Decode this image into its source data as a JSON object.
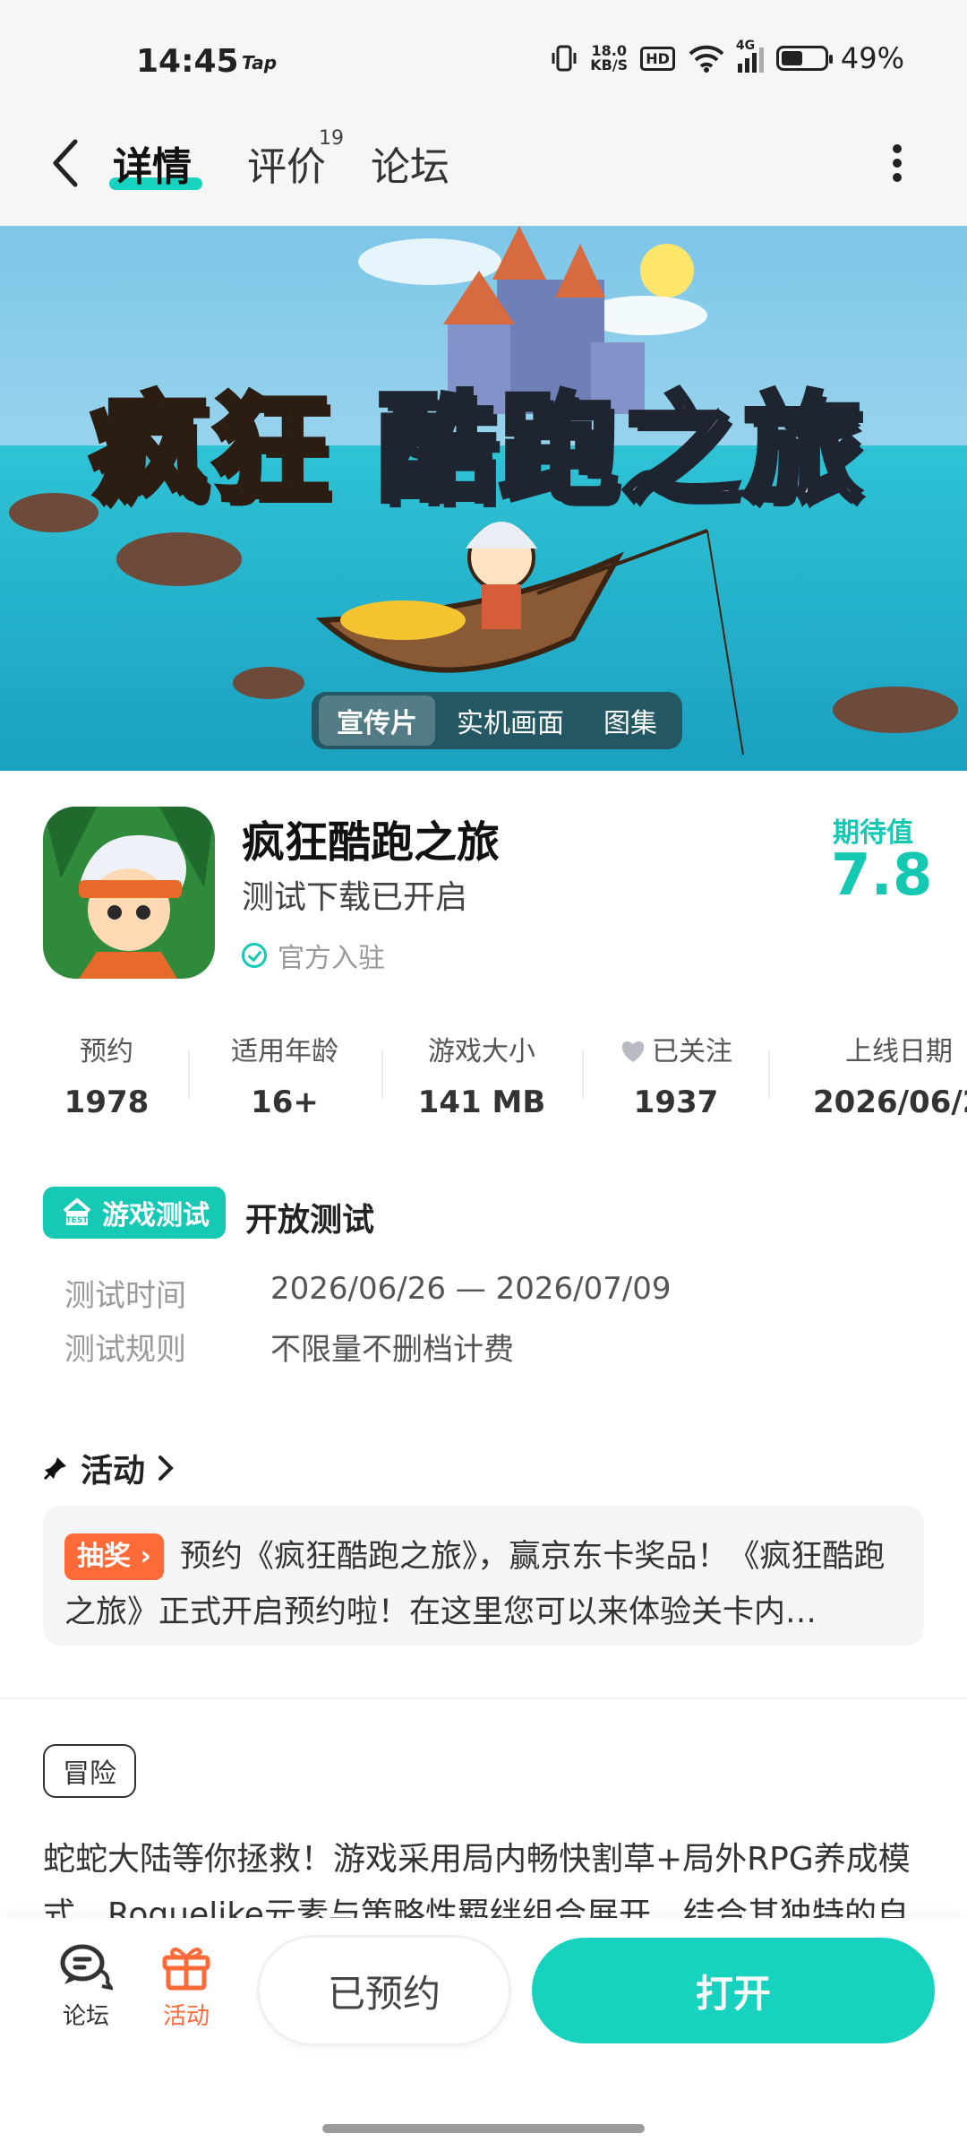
{
  "status_bar": {
    "time": "14:45",
    "app_badge": "Tap",
    "net_speed_value": "18.0",
    "net_speed_unit": "KB/S",
    "hd": "HD",
    "signal": "4G",
    "battery": "49%",
    "battery_level": 0.49
  },
  "nav": {
    "tabs": [
      {
        "label": "详情",
        "active": true
      },
      {
        "label": "评价",
        "count": "19"
      },
      {
        "label": "论坛"
      }
    ]
  },
  "hero": {
    "title_part1": "疯狂",
    "title_part2": "酷跑之旅",
    "media_tabs": [
      "宣传片",
      "实机画面",
      "图集"
    ]
  },
  "game": {
    "name": "疯狂酷跑之旅",
    "subtitle": "测试下载已开启",
    "official": "官方入驻",
    "expect_label": "期待值",
    "expect_value": "7.8"
  },
  "stats": [
    {
      "label": "预约",
      "value": "1978"
    },
    {
      "label": "适用年龄",
      "value": "16+"
    },
    {
      "label": "游戏大小",
      "value": "141 MB"
    },
    {
      "label": "已关注",
      "value": "1937"
    },
    {
      "label": "上线日期",
      "value": "2026/06/2"
    }
  ],
  "test": {
    "badge": "游戏测试",
    "badge_icon_text": "TEST",
    "type": "开放测试",
    "rows": [
      {
        "label": "测试时间",
        "value": "2026/06/26 — 2026/07/09"
      },
      {
        "label": "测试规则",
        "value": "不限量不删档计费"
      }
    ]
  },
  "activity": {
    "title": "活动",
    "tag": "抽奖",
    "text": "预约《疯狂酷跑之旅》，赢京东卡奖品！《疯狂酷跑之旅》正式开启预约啦！在这里您可以来体验关卡内…"
  },
  "genre_tag": "冒险",
  "description": "蛇蛇大陆等你拯救！游戏采用局内畅快割草+局外RPG养成模式，Roguelike元素与策略性羁绊组合展开，结合其独特的自",
  "bottom": {
    "forum": "论坛",
    "activity": "活动",
    "reserved": "已预约",
    "open": "打开"
  },
  "colors": {
    "accent": "#16d2be",
    "orange": "#ff6a39"
  }
}
